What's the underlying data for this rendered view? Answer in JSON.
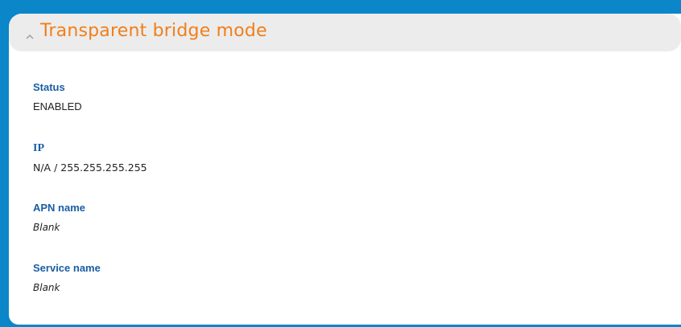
{
  "panel": {
    "title": "Transparent bridge mode",
    "collapse_icon": "chevron-up-icon"
  },
  "fields": [
    {
      "label": "Status",
      "value": "ENABLED"
    },
    {
      "label": "IP",
      "value": "N/A / 255.255.255.255"
    },
    {
      "label": "APN name",
      "value": "Blank"
    },
    {
      "label": "Service name",
      "value": "Blank"
    }
  ],
  "colors": {
    "background": "#0a86c9",
    "header_bg": "#ececec",
    "title": "#f07f1b",
    "label": "#1a5ea3",
    "value": "#222222"
  }
}
